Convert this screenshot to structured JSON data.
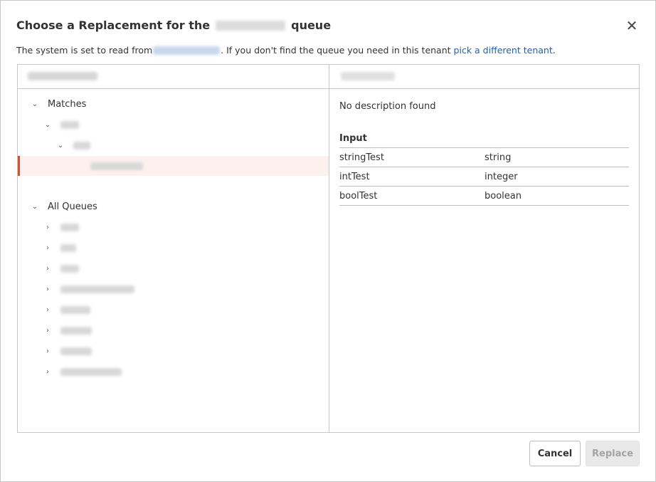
{
  "dialog": {
    "title_prefix": "Choose a Replacement for the",
    "title_suffix": "queue",
    "close_glyph": "✕",
    "subtitle_prefix": "The system is set to read from",
    "subtitle_middle": ". If you don't find the queue you need in this tenant",
    "subtitle_link": "pick a different tenant",
    "subtitle_end": "."
  },
  "tree": {
    "matches_label": "Matches",
    "all_queues_label": "All Queues",
    "expanded_caret": "⌄",
    "collapsed_caret": "›"
  },
  "detail": {
    "description": "No description found",
    "section_title": "Input",
    "rows": [
      {
        "name": "stringTest",
        "type": "string"
      },
      {
        "name": "intTest",
        "type": "integer"
      },
      {
        "name": "boolTest",
        "type": "boolean"
      }
    ]
  },
  "buttons": {
    "cancel": "Cancel",
    "replace": "Replace"
  },
  "colors": {
    "accent": "#d4512f",
    "link": "#2660a4",
    "selected_bg": "#fdf1ef"
  }
}
